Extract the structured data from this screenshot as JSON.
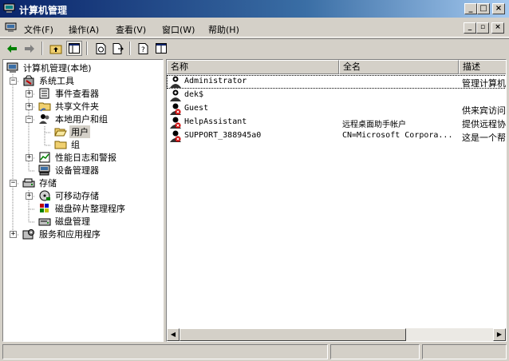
{
  "window": {
    "title": "计算机管理",
    "controls": {
      "minimize": "_",
      "maximize": "□",
      "close": "×"
    }
  },
  "menu": {
    "items": [
      {
        "label": "文件(F)"
      },
      {
        "label": "操作(A)"
      },
      {
        "label": "查看(V)"
      },
      {
        "label": "窗口(W)"
      },
      {
        "label": "帮助(H)"
      }
    ],
    "child_controls": {
      "minimize": "_",
      "restore": "▫",
      "close": "×"
    }
  },
  "toolbar": {
    "buttons": [
      "back-icon",
      "forward-icon",
      "up-folder-icon",
      "show-hide-tree-icon",
      "refresh-icon",
      "export-list-icon",
      "help-icon",
      "properties-icon"
    ]
  },
  "tree": {
    "root": "计算机管理(本地)",
    "system_tools": "系统工具",
    "event_viewer": "事件查看器",
    "shared_folders": "共享文件夹",
    "local_users_groups": "本地用户和组",
    "users": "用户",
    "groups": "组",
    "perf_logs": "性能日志和警报",
    "device_manager": "设备管理器",
    "storage": "存储",
    "removable_storage": "可移动存储",
    "disk_defrag": "磁盘碎片整理程序",
    "disk_management": "磁盘管理",
    "services_apps": "服务和应用程序",
    "expander_plus": "+",
    "expander_minus": "−"
  },
  "list": {
    "columns": [
      "名称",
      "全名",
      "描述"
    ],
    "rows": [
      {
        "name": "Administrator",
        "full_name": "",
        "description": "管理计算机",
        "disabled": false
      },
      {
        "name": "dek$",
        "full_name": "",
        "description": "",
        "disabled": false
      },
      {
        "name": "Guest",
        "full_name": "",
        "description": "供来宾访问",
        "disabled": true
      },
      {
        "name": "HelpAssistant",
        "full_name": "远程桌面助手帐户",
        "description": "提供远程协",
        "disabled": true
      },
      {
        "name": "SUPPORT_388945a0",
        "full_name": "CN=Microsoft Corpora...",
        "description": "这是一个帮",
        "disabled": true
      }
    ]
  },
  "scrollbar": {
    "left": "◀",
    "right": "▶"
  },
  "colors": {
    "title_start": "#0a246a",
    "title_end": "#a6caf0",
    "face": "#d4d0c8",
    "disabled_mark": "#cc0000"
  }
}
